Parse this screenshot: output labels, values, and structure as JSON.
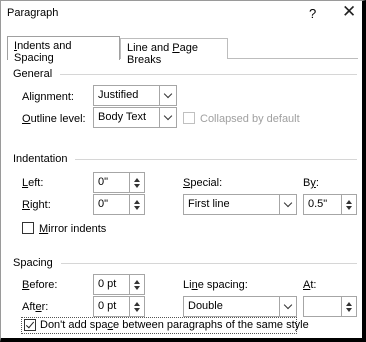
{
  "dialog": {
    "title": "Paragraph",
    "help": "?",
    "close": "✕"
  },
  "tabs": [
    {
      "label_pre": "",
      "label_u": "I",
      "label_post": "ndents and Spacing",
      "active": true
    },
    {
      "label_pre": "Line and ",
      "label_u": "P",
      "label_post": "age Breaks",
      "active": false
    }
  ],
  "general": {
    "heading": "General",
    "alignment": {
      "label_pre": "Ali",
      "label_u": "g",
      "label_post": "nment:",
      "value": "Justified"
    },
    "outline": {
      "label_pre": "",
      "label_u": "O",
      "label_post": "utline level:",
      "value": "Body Text"
    },
    "collapsed": {
      "label": "Collapsed by default",
      "checked": false,
      "enabled": false
    }
  },
  "indentation": {
    "heading": "Indentation",
    "left": {
      "label_pre": "",
      "label_u": "L",
      "label_post": "eft:",
      "value": "0\""
    },
    "right": {
      "label_pre": "",
      "label_u": "R",
      "label_post": "ight:",
      "value": "0\""
    },
    "special": {
      "label_pre": "",
      "label_u": "S",
      "label_post": "pecial:",
      "value": "First line"
    },
    "by": {
      "label_pre": "B",
      "label_u": "y",
      "label_post": ":",
      "value": "0.5\""
    },
    "mirror": {
      "label_pre": "",
      "label_u": "M",
      "label_post": "irror indents",
      "checked": false
    }
  },
  "spacing": {
    "heading": "Spacing",
    "before": {
      "label_pre": "",
      "label_u": "B",
      "label_post": "efore:",
      "value": "0 pt"
    },
    "after": {
      "label_pre": "Aft",
      "label_u": "e",
      "label_post": "r:",
      "value": "0 pt"
    },
    "line_spacing": {
      "label_pre": "Li",
      "label_u": "n",
      "label_post": "e spacing:",
      "value": "Double"
    },
    "at": {
      "label_pre": "",
      "label_u": "A",
      "label_post": "t:",
      "value": ""
    },
    "dont_add": {
      "label_pre": "Don't add spa",
      "label_u": "c",
      "label_post": "e between paragraphs of the same style",
      "checked": true
    }
  }
}
